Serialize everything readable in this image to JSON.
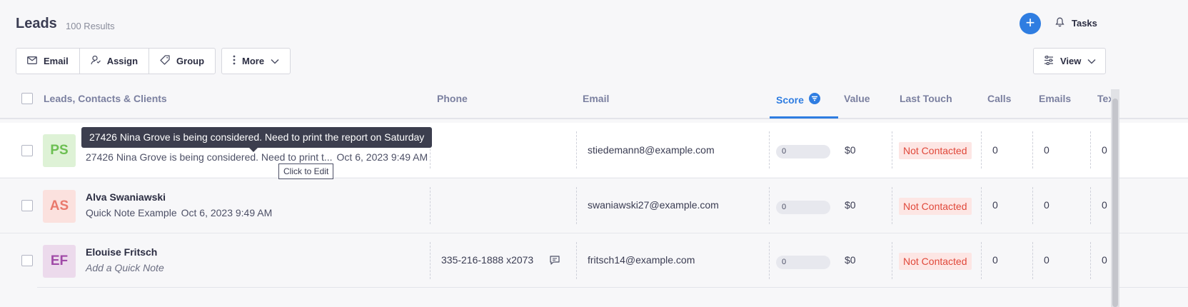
{
  "header": {
    "title": "Leads",
    "results": "100 Results",
    "add_label": "+",
    "tasks_label": "Tasks"
  },
  "toolbar": {
    "email_label": "Email",
    "assign_label": "Assign",
    "group_label": "Group",
    "more_label": "More",
    "view_label": "View"
  },
  "columns": {
    "leads": "Leads, Contacts & Clients",
    "phone": "Phone",
    "email": "Email",
    "score": "Score",
    "value": "Value",
    "last_touch": "Last Touch",
    "calls": "Calls",
    "emails": "Emails",
    "texts": "Tex"
  },
  "tooltip": {
    "text": "27426 Nina Grove is being considered. Need to print the report on Saturday",
    "click_to_edit": "Click to Edit"
  },
  "rows": [
    {
      "initials": "PS",
      "name": "",
      "note": "27426 Nina Grove is being considered. Need to print t...",
      "timestamp": "Oct 6, 2023 9:49 AM",
      "phone": "",
      "email": "stiedemann8@example.com",
      "score": "0",
      "value": "$0",
      "last_touch": "Not Contacted",
      "calls": "0",
      "emails": "0",
      "texts": "0"
    },
    {
      "initials": "AS",
      "name": "Alva Swaniawski",
      "note": "Quick Note Example",
      "timestamp": "Oct 6, 2023 9:49 AM",
      "phone": "",
      "email": "swaniawski27@example.com",
      "score": "0",
      "value": "$0",
      "last_touch": "Not Contacted",
      "calls": "0",
      "emails": "0",
      "texts": "0"
    },
    {
      "initials": "EF",
      "name": "Elouise Fritsch",
      "note": "Add a Quick Note",
      "timestamp": "",
      "phone": "335-216-1888 x2073",
      "email": "fritsch14@example.com",
      "score": "0",
      "value": "$0",
      "last_touch": "Not Contacted",
      "calls": "0",
      "emails": "0",
      "texts": "0"
    }
  ],
  "colors": {
    "accent": "#2f7de1",
    "status_red": "#e0483a",
    "status_bg": "#fde6e4"
  }
}
